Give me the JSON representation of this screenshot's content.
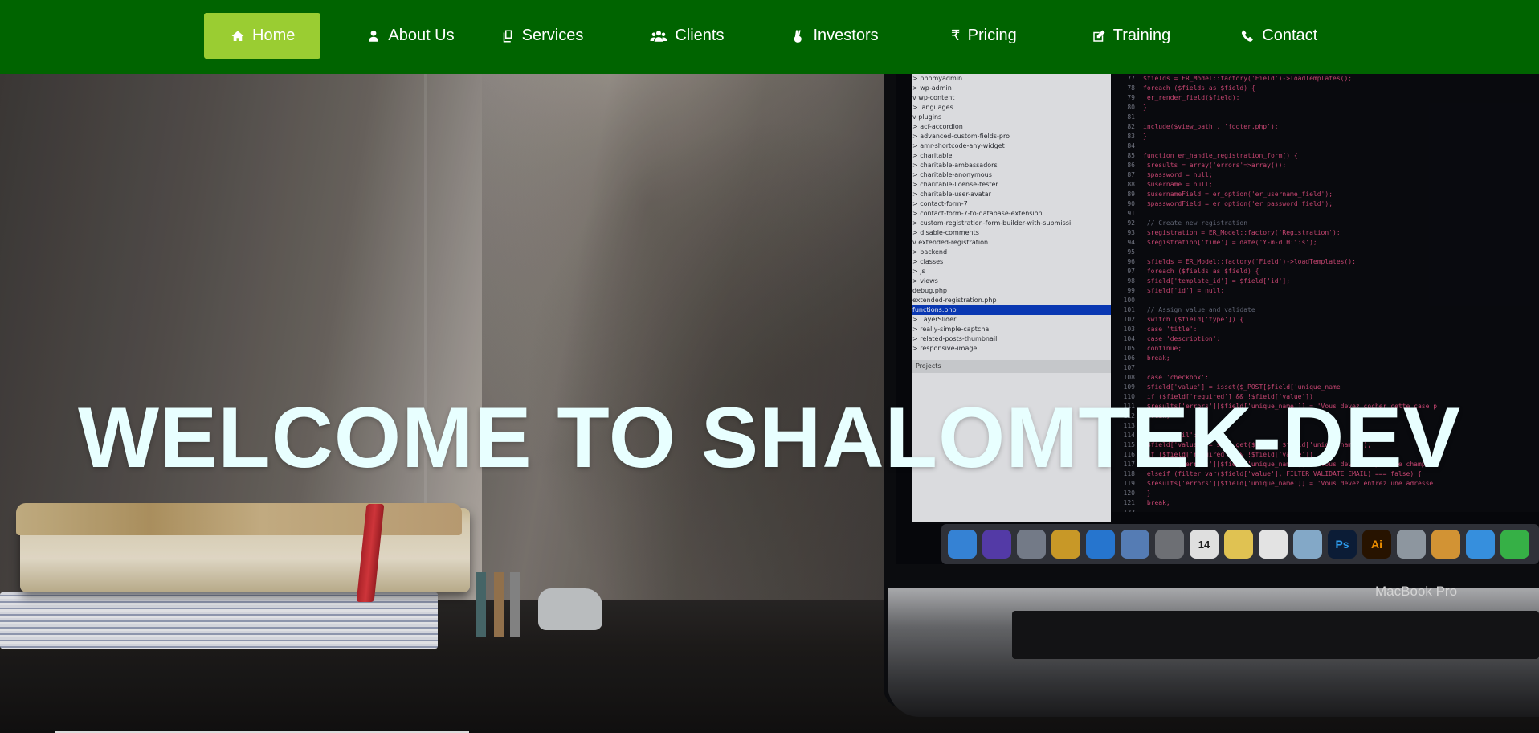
{
  "nav": {
    "items": [
      {
        "label": "Home",
        "icon": "home-icon",
        "active": true
      },
      {
        "label": "About Us",
        "icon": "user-icon",
        "active": false
      },
      {
        "label": "Services",
        "icon": "copy-icon",
        "active": false
      },
      {
        "label": "Clients",
        "icon": "users-icon",
        "active": false
      },
      {
        "label": "Investors",
        "icon": "hand-peace-icon",
        "active": false
      },
      {
        "label": "Pricing",
        "icon": "rupee-icon",
        "active": false
      },
      {
        "label": "Training",
        "icon": "edit-icon",
        "active": false
      },
      {
        "label": "Contact",
        "icon": "phone-icon",
        "active": false
      }
    ]
  },
  "hero": {
    "title": "WELCOME TO SHALOMTEK-DEV",
    "laptop_brand": "MacBook Pro",
    "file_tree": [
      "> phpmyadmin",
      "> wp-admin",
      "v wp-content",
      "   > languages",
      "   v plugins",
      "      > acf-accordion",
      "      > advanced-custom-fields-pro",
      "      > amr-shortcode-any-widget",
      "      > charitable",
      "      > charitable-ambassadors",
      "      > charitable-anonymous",
      "      > charitable-license-tester",
      "      > charitable-user-avatar",
      "      > contact-form-7",
      "      > contact-form-7-to-database-extension",
      "      > custom-registration-form-builder-with-submissi",
      "      > disable-comments",
      "      v extended-registration",
      "         > backend",
      "         > classes",
      "         > js",
      "         > views",
      "           debug.php",
      "           extended-registration.php",
      "           functions.php",
      "      > LayerSlider",
      "      > really-simple-captcha",
      "      > related-posts-thumbnail",
      "      > responsive-image"
    ],
    "projects_label": "Projects",
    "code_lines": [
      {
        "n": "77",
        "t": "$fields = ER_Model::factory('Field')->loadTemplates();"
      },
      {
        "n": "78",
        "t": "foreach ($fields as $field) {"
      },
      {
        "n": "79",
        "t": "   er_render_field($field);"
      },
      {
        "n": "80",
        "t": "}"
      },
      {
        "n": "81",
        "t": ""
      },
      {
        "n": "82",
        "t": "include($view_path . 'footer.php');"
      },
      {
        "n": "83",
        "t": "}"
      },
      {
        "n": "84",
        "t": ""
      },
      {
        "n": "85",
        "t": "function er_handle_registration_form() {"
      },
      {
        "n": "86",
        "t": "  $results = array('errors'=>array());"
      },
      {
        "n": "87",
        "t": "  $password = null;"
      },
      {
        "n": "88",
        "t": "  $username = null;"
      },
      {
        "n": "89",
        "t": "  $usernameField = er_option('er_username_field');"
      },
      {
        "n": "90",
        "t": "  $passwordField = er_option('er_password_field');"
      },
      {
        "n": "91",
        "t": ""
      },
      {
        "n": "92",
        "t": "  // Create new registration"
      },
      {
        "n": "93",
        "t": "  $registration = ER_Model::factory('Registration');"
      },
      {
        "n": "94",
        "t": "  $registration['time'] = date('Y-m-d H:i:s');"
      },
      {
        "n": "95",
        "t": ""
      },
      {
        "n": "96",
        "t": "  $fields = ER_Model::factory('Field')->loadTemplates();"
      },
      {
        "n": "97",
        "t": "  foreach ($fields as $field) {"
      },
      {
        "n": "98",
        "t": "     $field['template_id'] = $field['id'];"
      },
      {
        "n": "99",
        "t": "     $field['id'] = null;"
      },
      {
        "n": "100",
        "t": ""
      },
      {
        "n": "101",
        "t": "     // Assign value and validate"
      },
      {
        "n": "102",
        "t": "     switch ($field['type']) {"
      },
      {
        "n": "103",
        "t": "        case 'title':"
      },
      {
        "n": "104",
        "t": "        case 'description':"
      },
      {
        "n": "105",
        "t": "           continue;"
      },
      {
        "n": "106",
        "t": "           break;"
      },
      {
        "n": "107",
        "t": ""
      },
      {
        "n": "108",
        "t": "        case 'checkbox':"
      },
      {
        "n": "109",
        "t": "           $field['value'] = isset($_POST[$field['unique_name"
      },
      {
        "n": "110",
        "t": "           if ($field['required'] && !$field['value'])"
      },
      {
        "n": "111",
        "t": "              $results['errors'][$field['unique_name']] = 'Vous devez cocher cette case p"
      },
      {
        "n": "112",
        "t": "           break;"
      },
      {
        "n": "113",
        "t": ""
      },
      {
        "n": "114",
        "t": "        case 'email':"
      },
      {
        "n": "115",
        "t": "           $field['value'] = safe_get($_POST, $field['unique_name']);"
      },
      {
        "n": "116",
        "t": "           if ($field['required'] && !$field['value'])"
      },
      {
        "n": "117",
        "t": "              $results['errors'][$field['unique_name']] = 'Vous devez remplir ce champs."
      },
      {
        "n": "118",
        "t": "           elseif (filter_var($field['value'], FILTER_VALIDATE_EMAIL) === false) {"
      },
      {
        "n": "119",
        "t": "              $results['errors'][$field['unique_name']] = 'Vous devez entrez une adresse"
      },
      {
        "n": "120",
        "t": "           }"
      },
      {
        "n": "121",
        "t": "           break;"
      },
      {
        "n": "122",
        "t": ""
      },
      {
        "n": "123",
        "t": "        case 'password':"
      }
    ],
    "dock_apps": [
      {
        "name": "finder",
        "color": "#3a8ee6",
        "label": ""
      },
      {
        "name": "siri",
        "color": "#5b3fb5",
        "label": ""
      },
      {
        "name": "launchpad",
        "color": "#7d8593",
        "label": ""
      },
      {
        "name": "chrome",
        "color": "#d9a52b",
        "label": ""
      },
      {
        "name": "safari",
        "color": "#2a7fe0",
        "label": ""
      },
      {
        "name": "preview",
        "color": "#5d87c4",
        "label": ""
      },
      {
        "name": "system-preferences",
        "color": "#77797e",
        "label": ""
      },
      {
        "name": "calendar",
        "color": "#f2f2f2",
        "label": "14"
      },
      {
        "name": "notes",
        "color": "#f3d35a",
        "label": ""
      },
      {
        "name": "reminders",
        "color": "#f7f7f7",
        "label": ""
      },
      {
        "name": "photos-folder",
        "color": "#8fb7d8",
        "label": ""
      },
      {
        "name": "photoshop",
        "color": "#0d1f3b",
        "label": "Ps"
      },
      {
        "name": "illustrator",
        "color": "#2b1500",
        "label": "Ai"
      },
      {
        "name": "app-store",
        "color": "#9aa3ad",
        "label": ""
      },
      {
        "name": "photos",
        "color": "#e4a039",
        "label": ""
      },
      {
        "name": "messages",
        "color": "#3b9cf0",
        "label": ""
      },
      {
        "name": "facetime",
        "color": "#3bbf4c",
        "label": ""
      }
    ]
  },
  "colors": {
    "nav_bg": "#006400",
    "nav_active": "#9acd32",
    "title": "#e8ffff"
  }
}
